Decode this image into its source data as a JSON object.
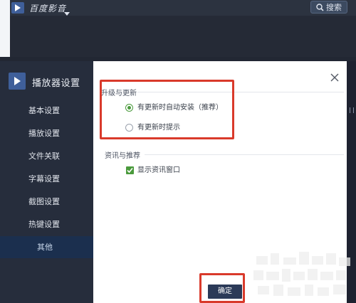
{
  "app": {
    "title": "百度影音",
    "search_label": "搜索"
  },
  "dialog": {
    "title": "播放器设置",
    "sidebar": {
      "items": [
        {
          "label": "基本设置"
        },
        {
          "label": "播放设置"
        },
        {
          "label": "文件关联"
        },
        {
          "label": "字幕设置"
        },
        {
          "label": "截图设置"
        },
        {
          "label": "热键设置"
        },
        {
          "label": "其他"
        }
      ],
      "active": "其他"
    },
    "sections": {
      "update": {
        "title": "升级与更新",
        "options": [
          {
            "label": "有更新时自动安装（推荐）",
            "selected": true
          },
          {
            "label": "有更新时提示",
            "selected": false
          }
        ]
      },
      "news": {
        "title": "资讯与推荐",
        "checkbox": {
          "label": "显示资讯窗口",
          "checked": true
        }
      }
    },
    "ok_label": "确定"
  },
  "colors": {
    "sidebar_bg": "#262d3c",
    "active_item_bg": "#1b2f4e",
    "accent_green": "#4a9a3c",
    "ok_button_bg": "#2b3a58",
    "highlight_red": "#d93a2b"
  },
  "icons": {
    "app_logo": "play-logo-icon",
    "app_dropdown": "chevron-down-icon",
    "search": "search-icon",
    "close": "close-icon",
    "checkbox": "checkmark-icon"
  }
}
